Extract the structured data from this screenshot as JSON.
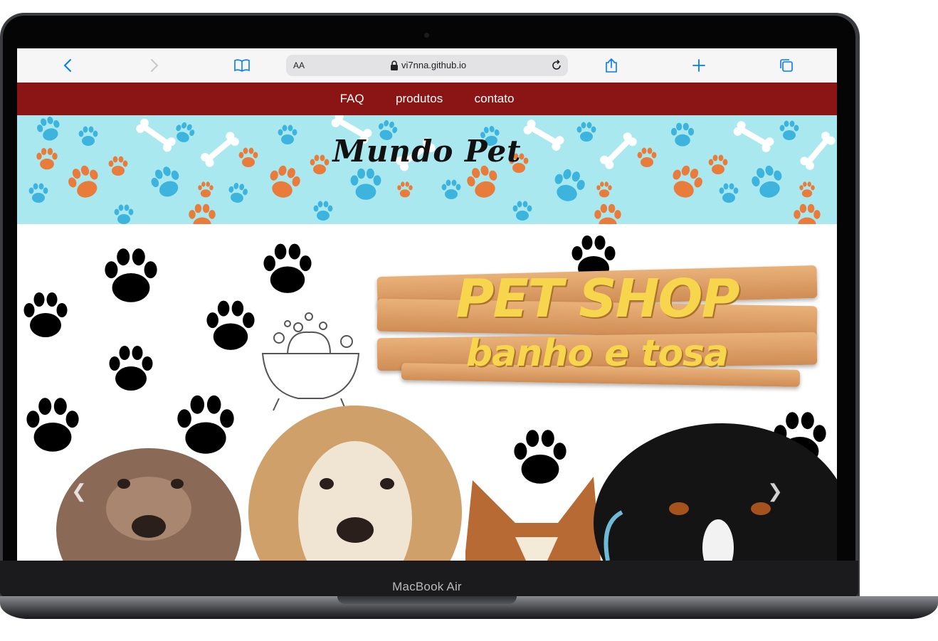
{
  "device": {
    "label": "MacBook Air"
  },
  "browser": {
    "address_size_label": "AA",
    "url": "vi7nna.github.io",
    "toolbar_icons": [
      "chevron-left-icon",
      "chevron-right-icon",
      "book-icon",
      "reload-icon",
      "share-icon",
      "plus-icon",
      "tabs-icon"
    ]
  },
  "site": {
    "nav": {
      "items": [
        {
          "label": "FAQ"
        },
        {
          "label": "produtos"
        },
        {
          "label": "contato"
        }
      ]
    },
    "hero": {
      "logo": "Mundo Pet"
    },
    "banner": {
      "title": "PET SHOP",
      "subtitle": "banho e tosa",
      "prev_icon": "chevron-left-icon",
      "next_icon": "chevron-right-icon"
    }
  },
  "colors": {
    "nav_background": "#8b1414",
    "hero_background": "#a9e8ef",
    "paw_blue": "#3cb4de",
    "paw_orange": "#e97c3a",
    "sign_text": "#f7d54c",
    "ios_blue": "#007aff"
  }
}
